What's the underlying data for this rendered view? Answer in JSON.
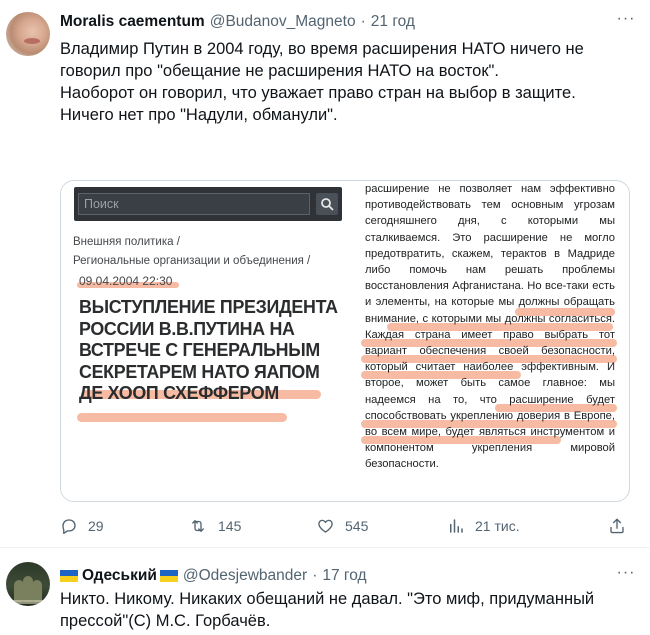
{
  "tweet1": {
    "author_name": "Moralis caementum",
    "handle": "@Budanov_Magneto",
    "separator": "·",
    "time": "21 год",
    "more_label": "···",
    "text_paragraphs": [
      "Владимир Путин в 2004 году, во время расширения НАТО ничего не говорил про \"обещание не расширения НАТО на восток\".",
      "Наоборот он говорил, что уважает право стран на выбор в защите.",
      "Ничего нет про \"Надули, обманули\"."
    ],
    "media": {
      "search_placeholder": "Поиск",
      "breadcrumb_1": "Внешняя политика  /",
      "breadcrumb_2": "Региональные организации и объединения  /",
      "date": "09.04.2004 22:30",
      "title": "ВЫСТУПЛЕНИЕ ПРЕЗИДЕНТА РОССИИ В.В.ПУТИНА НА ВСТРЕЧЕ С ГЕНЕРАЛЬНЫМ СЕКРЕТАРЕМ НАТО ЯАПОМ ДЕ ХООП СХЕФФЕРОМ",
      "body": "расширение не позволяет нам эффективно противодействовать тем основным угрозам сегодняшнего дня, с которыми мы сталкиваемся. Это расширение не могло предотвратить, скажем, терактов в Мадриде либо помочь нам решать проблемы восстановления Афганистана. Но все-таки есть и элементы, на которые мы должны обращать внимание, с которыми мы должны согласиться. Каждая страна имеет право выбрать тот вариант обеспечения своей безопасности, который считает наиболее эффективным. И второе, может быть самое главное: мы надеемся на то, что расширение будет способствовать укреплению доверия в Европе, во всем мире, будет являться инструментом и компонентом укрепления мировой безопасности."
    },
    "actions": {
      "replies": "29",
      "retweets": "145",
      "likes": "545",
      "views": "21 тис."
    }
  },
  "tweet2": {
    "author_name": "Одеський",
    "handle": "@Odesjewbander",
    "separator": "·",
    "time": "17 год",
    "more_label": "···",
    "text": "Никто. Никому. Никаких обещаний не давал. \"Это миф, придуманный прессой\"(С) М.С. Горбачёв."
  },
  "colors": {
    "text_primary": "#0f1419",
    "text_secondary": "#536471",
    "highlight": "#f4a07e",
    "flag_blue": "#1d64c4",
    "flag_yellow": "#f7cf1d"
  },
  "icons": [
    "reply-icon",
    "retweet-icon",
    "like-icon",
    "views-icon",
    "share-icon",
    "search-icon",
    "more-icon"
  ]
}
